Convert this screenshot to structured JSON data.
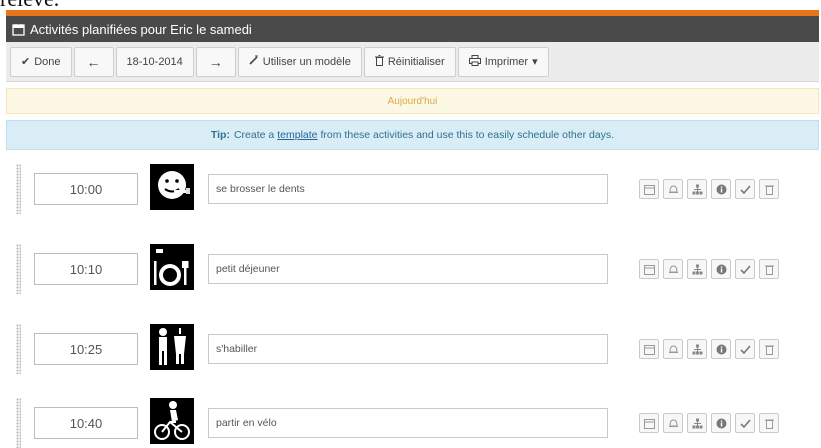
{
  "doc_text": "relevé.",
  "window": {
    "title": "Activités planifiées pour Eric le samedi"
  },
  "toolbar": {
    "done_label": "Done",
    "date_value": "18-10-2014",
    "template_label": "Utiliser un modèle",
    "reset_label": "Réinitialiser",
    "print_label": "Imprimer"
  },
  "today_label": "Aujourd'hui",
  "tip": {
    "prefix": "Tip:",
    "before_link": "Create a",
    "link_text": "template",
    "after_link": "from these activities and use this to easily schedule other days."
  },
  "activities": [
    {
      "time": "10:00",
      "description": "se brosser le dents",
      "pictogram": "toothbrush-face-icon"
    },
    {
      "time": "10:10",
      "description": "petit déjeuner",
      "pictogram": "breakfast-icon"
    },
    {
      "time": "10:25",
      "description": "s'habiller",
      "pictogram": "dressing-icon"
    },
    {
      "time": "10:40",
      "description": "partir en vélo",
      "pictogram": "bicycle-icon"
    }
  ],
  "colors": {
    "accent": "#e8751a",
    "title_bar": "#4a4a4a",
    "today_bg": "#fcf8e3",
    "today_text": "#d9a94a",
    "tip_bg": "#d9edf7",
    "tip_text": "#31708f"
  }
}
